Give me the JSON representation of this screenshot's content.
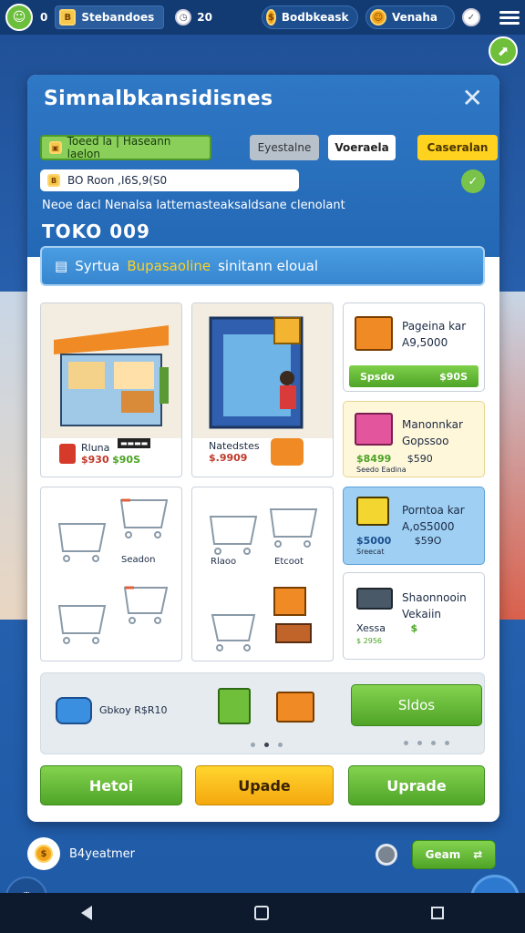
{
  "topbar": {
    "count": "0",
    "tab1_label": "Stebandoes",
    "stat1": "20",
    "pill1_label": "Bodbkeask",
    "pill2_label": "Venaha"
  },
  "panel": {
    "title": "Simnalbkansidisnes",
    "chip_green": "Toeed la | Haseann laelon",
    "chip_grey": "Eyestalne",
    "chip_white": "Voeraela",
    "chip_yellow": "Caseralan",
    "input_value": "BO Roon ,I6S,9(S0",
    "description": "Neoe dacl Nenalsa lattemasteaksaldsane clenolant",
    "big_number": "TOKO 009",
    "banner_prefix": "Syrtua",
    "banner_highlight": "Bupasaoline",
    "banner_suffix": "sinitann eloual"
  },
  "grid": {
    "card1": {
      "name": "Rluna",
      "price1": "$930",
      "price2": "$90S"
    },
    "card2": {
      "name": "Natedstes",
      "price1": "$.9909"
    },
    "card3": {
      "label": "Seadon"
    },
    "card4": {
      "label1": "Rlaoo",
      "label2": "Etcoot"
    }
  },
  "side_cards": [
    {
      "title1": "Pageina kar",
      "title2": "A9,5000",
      "button_left": "Spsdo",
      "button_right": "$90S"
    },
    {
      "title1": "Manonnkar",
      "title2": "Gopssoo",
      "price1": "$8499",
      "price2": "$590",
      "sub": "Seedo Eadina"
    },
    {
      "title1": "Porntoa kar",
      "title2": "A,oS5000",
      "price1": "$5000",
      "price2": "$59O",
      "sub": "Sreecat"
    },
    {
      "title1": "Shaonnooin",
      "title2": "Vekaiin",
      "price1": "Xessa",
      "price2": "$",
      "sub": "$ 2956"
    }
  ],
  "footer": {
    "promo_label": "Gbkoy R$R10",
    "slide_button": "Sldos"
  },
  "actions": {
    "left": "Hetoi",
    "middle": "Upade",
    "right": "Uprade"
  },
  "bottom": {
    "label": "B4yeatmer",
    "go_label": "Geam"
  },
  "colors": {
    "primary_blue": "#2368b4",
    "green": "#4fa427",
    "yellow": "#ffd21f"
  }
}
